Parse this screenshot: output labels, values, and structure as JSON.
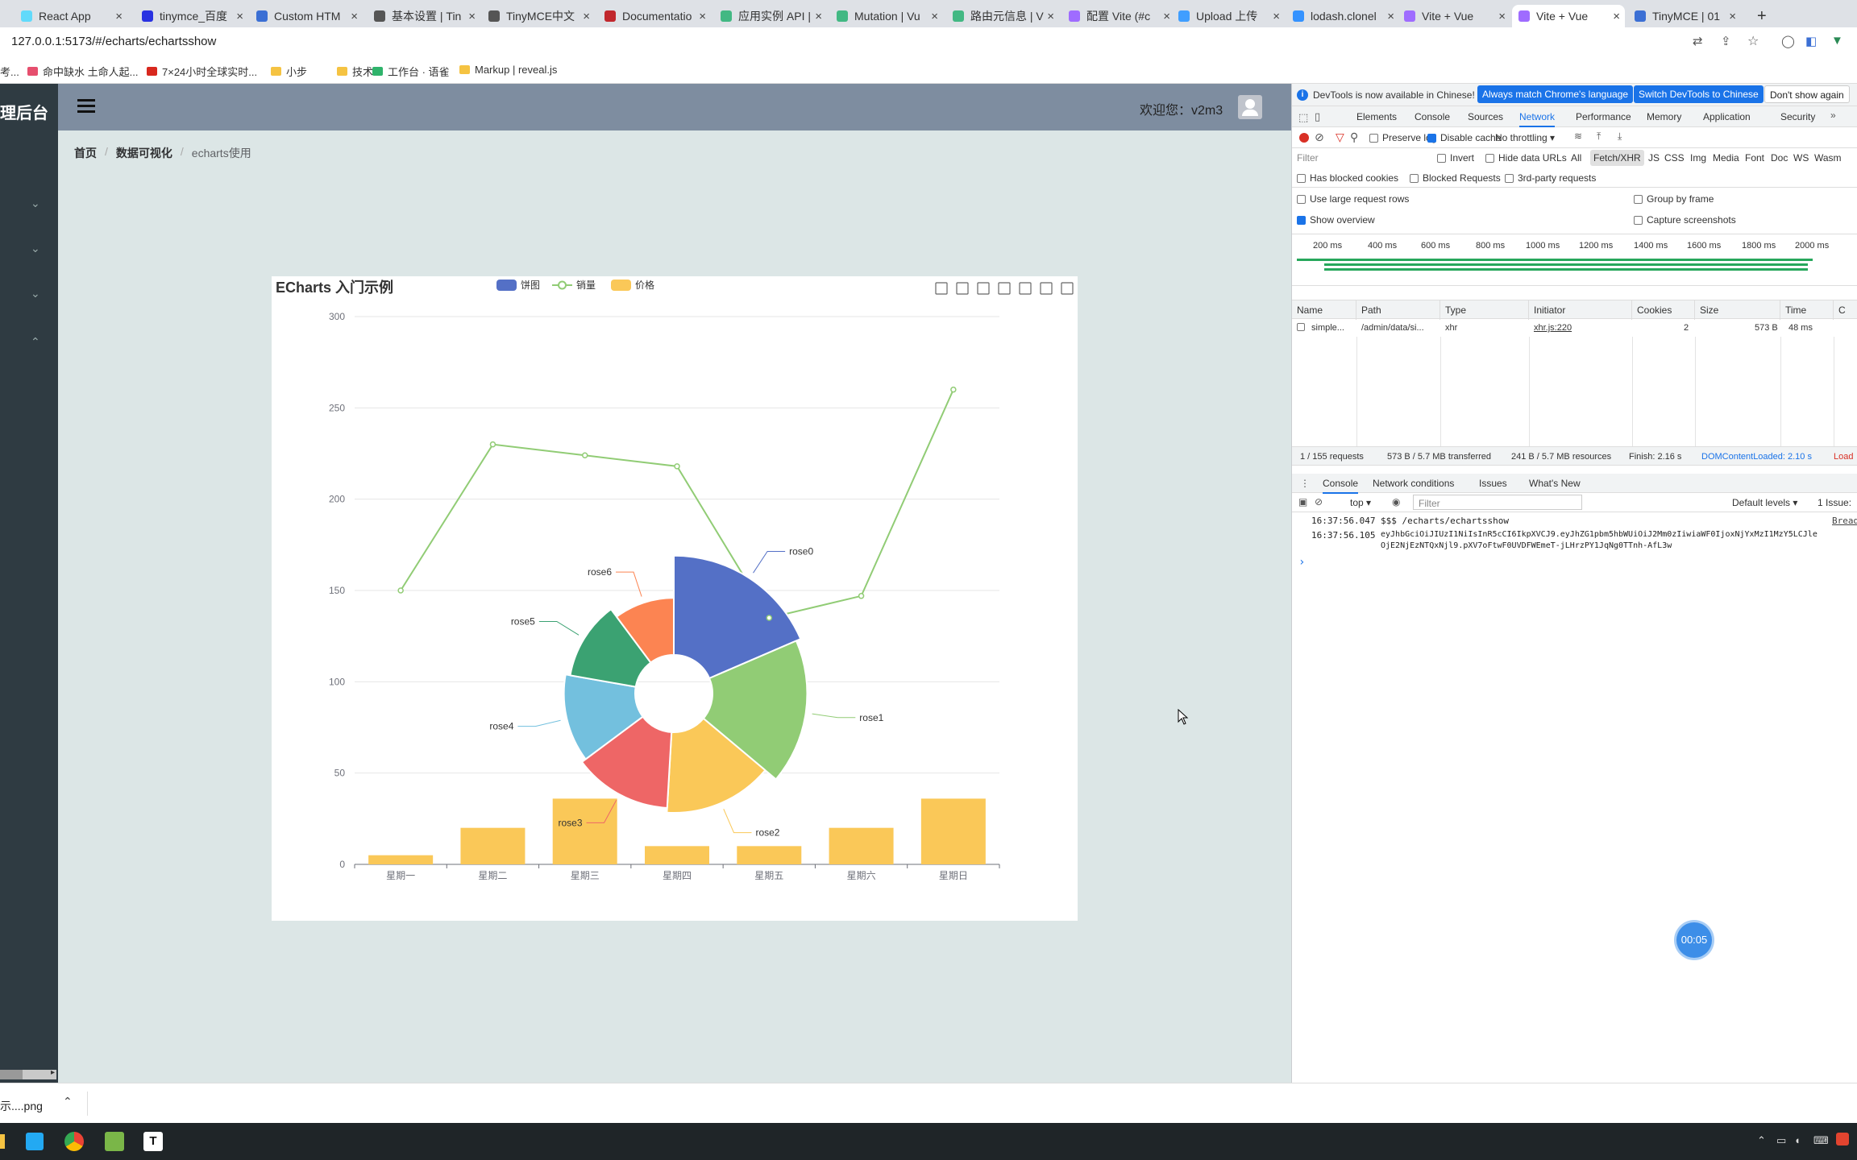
{
  "browser": {
    "tabs": [
      {
        "title": "React App",
        "color": "#61dafb"
      },
      {
        "title": "tinymce_百度",
        "color": "#2932e1"
      },
      {
        "title": "Custom HTM",
        "color": "#3b6fd4"
      },
      {
        "title": "基本设置 | Tin",
        "color": "#555"
      },
      {
        "title": "TinyMCE中文",
        "color": "#555"
      },
      {
        "title": "Documentatio",
        "color": "#c1272d"
      },
      {
        "title": "应用实例 API |",
        "color": "#42b883"
      },
      {
        "title": "Mutation | Vu",
        "color": "#42b883"
      },
      {
        "title": "路由元信息 | V",
        "color": "#42b883"
      },
      {
        "title": "配置 Vite (#c",
        "color": "#9f6cff"
      },
      {
        "title": "Upload 上传",
        "color": "#409eff"
      },
      {
        "title": "lodash.clonel",
        "color": "#3492ff"
      },
      {
        "title": "Vite + Vue",
        "color": "#9f6cff"
      },
      {
        "title": "Vite + Vue",
        "color": "#9f6cff"
      },
      {
        "title": "TinyMCE | 01",
        "color": "#3b6fd4"
      }
    ],
    "url": "127.0.0.1:5173/#/echarts/echartsshow",
    "bookmarks": [
      "考...",
      "命中缺水 土命人起...",
      "7×24小时全球实时...",
      "小步",
      "技术",
      "工作台 · 语雀",
      "Markup | reveal.js"
    ]
  },
  "app": {
    "brand": "理后台",
    "welcome": "欢迎您：v2m3",
    "breadcrumb": [
      "首页",
      "数据可视化",
      "echarts使用"
    ]
  },
  "chart_data": {
    "type": "bar",
    "title": "ECharts 入门示例",
    "legend": [
      "饼图",
      "销量",
      "价格"
    ],
    "legend_position": "top-center",
    "categories": [
      "星期一",
      "星期二",
      "星期三",
      "星期四",
      "星期五",
      "星期六",
      "星期日"
    ],
    "ylim": [
      0,
      300
    ],
    "yticks": [
      0,
      50,
      100,
      150,
      200,
      250,
      300
    ],
    "grid": true,
    "series": [
      {
        "name": "价格",
        "type": "bar",
        "color": "#fac858",
        "values": [
          5,
          20,
          36,
          10,
          10,
          20,
          36
        ]
      },
      {
        "name": "销量",
        "type": "line",
        "color": "#91cc75",
        "values": [
          150,
          230,
          224,
          218,
          135,
          147,
          260
        ]
      }
    ],
    "rose": {
      "name": "饼图",
      "labels": [
        "rose0",
        "rose1",
        "rose2",
        "rose3",
        "rose4",
        "rose5",
        "rose6"
      ],
      "values": [
        40,
        38,
        32,
        30,
        28,
        26,
        22
      ],
      "colors": [
        "#5470c6",
        "#91cc75",
        "#fac858",
        "#ee6666",
        "#73c0de",
        "#3ba272",
        "#fc8452"
      ]
    }
  },
  "devtools": {
    "info": "DevTools is now available in Chinese!",
    "btn_match": "Always match Chrome's language",
    "btn_switch": "Switch DevTools to Chinese",
    "btn_dismiss": "Don't show again",
    "tabs": [
      "Elements",
      "Console",
      "Sources",
      "Network",
      "Performance",
      "Memory",
      "Application",
      "Security"
    ],
    "preserve_log": "Preserve log",
    "disable_cache": "Disable cache",
    "throttling": "No throttling",
    "filter_placeholder": "Filter",
    "invert": "Invert",
    "hide_data": "Hide data URLs",
    "types": [
      "All",
      "Fetch/XHR",
      "JS",
      "CSS",
      "Img",
      "Media",
      "Font",
      "Doc",
      "WS",
      "Wasm"
    ],
    "has_blocked": "Has blocked cookies",
    "blocked_req": "Blocked Requests",
    "third_party": "3rd-party requests",
    "large_rows": "Use large request rows",
    "group_frame": "Group by frame",
    "show_overview": "Show overview",
    "capture": "Capture screenshots",
    "timeline": [
      "200 ms",
      "400 ms",
      "600 ms",
      "800 ms",
      "1000 ms",
      "1200 ms",
      "1400 ms",
      "1600 ms",
      "1800 ms",
      "2000 ms"
    ],
    "columns": [
      "Name",
      "Path",
      "Type",
      "Initiator",
      "Cookies",
      "Size",
      "Time",
      "C"
    ],
    "row": [
      "simple...",
      "/admin/data/si...",
      "xhr",
      "xhr.js:220",
      "2",
      "573 B",
      "48 ms"
    ],
    "summary": [
      "1 / 155 requests",
      "573 B / 5.7 MB transferred",
      "241 B / 5.7 MB resources",
      "Finish: 2.16 s",
      "DOMContentLoaded: 2.10 s",
      "Load"
    ],
    "drawer_tabs": [
      "Console",
      "Network conditions",
      "Issues",
      "What's New"
    ],
    "context": "top",
    "console_filter": "Filter",
    "levels": "Default levels",
    "issues": "1 Issue:",
    "logs": [
      {
        "time": "16:37:56.047",
        "text": "$$$ /echarts/echartsshow",
        "src": "Bread"
      },
      {
        "time": "16:37:56.105",
        "text": "eyJhbGciOiJIUzI1NiIsInR5cCI6IkpXVCJ9.eyJhZG1pbm5hbWUiOiJ2Mm0zIiwiaWF0IjoxNjYxMzI1MzY5LCJle",
        "text2": "OjE2NjEzNTQxNjl9.pXV7oFtwF0UVDFWEmeT-jLHrzPY1JqNg0TTnh-AfL3w"
      }
    ],
    "prompt": "›"
  },
  "timer": "00:05",
  "download": "示....png"
}
